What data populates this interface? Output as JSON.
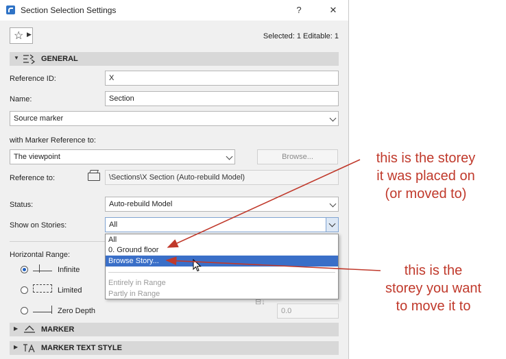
{
  "window": {
    "title": "Section Selection Settings",
    "help_label": "?",
    "close_label": "✕"
  },
  "toolbar": {
    "favorites_icon": "star-icon",
    "selection_info": "Selected: 1 Editable: 1"
  },
  "general": {
    "header": "GENERAL",
    "reference_id_label": "Reference ID:",
    "reference_id_value": "X",
    "name_label": "Name:",
    "name_value": "Section",
    "source_marker": "Source marker",
    "marker_ref_label": "with Marker Reference to:",
    "marker_ref_value": "The viewpoint",
    "browse_label": "Browse...",
    "reference_to_label": "Reference to:",
    "reference_to_value": "\\Sections\\X Section (Auto-rebuild Model)",
    "status_label": "Status:",
    "status_value": "Auto-rebuild Model",
    "show_on_stories_label": "Show on Stories:",
    "show_on_stories_value": "All",
    "horizontal_range_label": "Horizontal Range:",
    "range_options": [
      {
        "label": "Infinite",
        "selected": true
      },
      {
        "label": "Limited",
        "selected": false
      },
      {
        "label": "Zero Depth",
        "selected": false
      }
    ],
    "depth_value": "0.0"
  },
  "stories_dropdown": {
    "items": [
      {
        "label": "All",
        "state": "normal"
      },
      {
        "label": "0. Ground floor",
        "state": "normal"
      },
      {
        "label": "Browse Story...",
        "state": "highlighted"
      },
      {
        "label": "Entirely in Range",
        "state": "disabled"
      },
      {
        "label": "Partly in Range",
        "state": "disabled"
      }
    ]
  },
  "marker": {
    "header": "MARKER"
  },
  "marker_text_style": {
    "header": "MARKER TEXT STYLE"
  },
  "annotations": {
    "top": [
      "this is the storey",
      "it was placed on",
      "(or moved to)"
    ],
    "bottom": [
      "this is the",
      "storey you want",
      "to move it to"
    ],
    "color": "#c0392b"
  }
}
